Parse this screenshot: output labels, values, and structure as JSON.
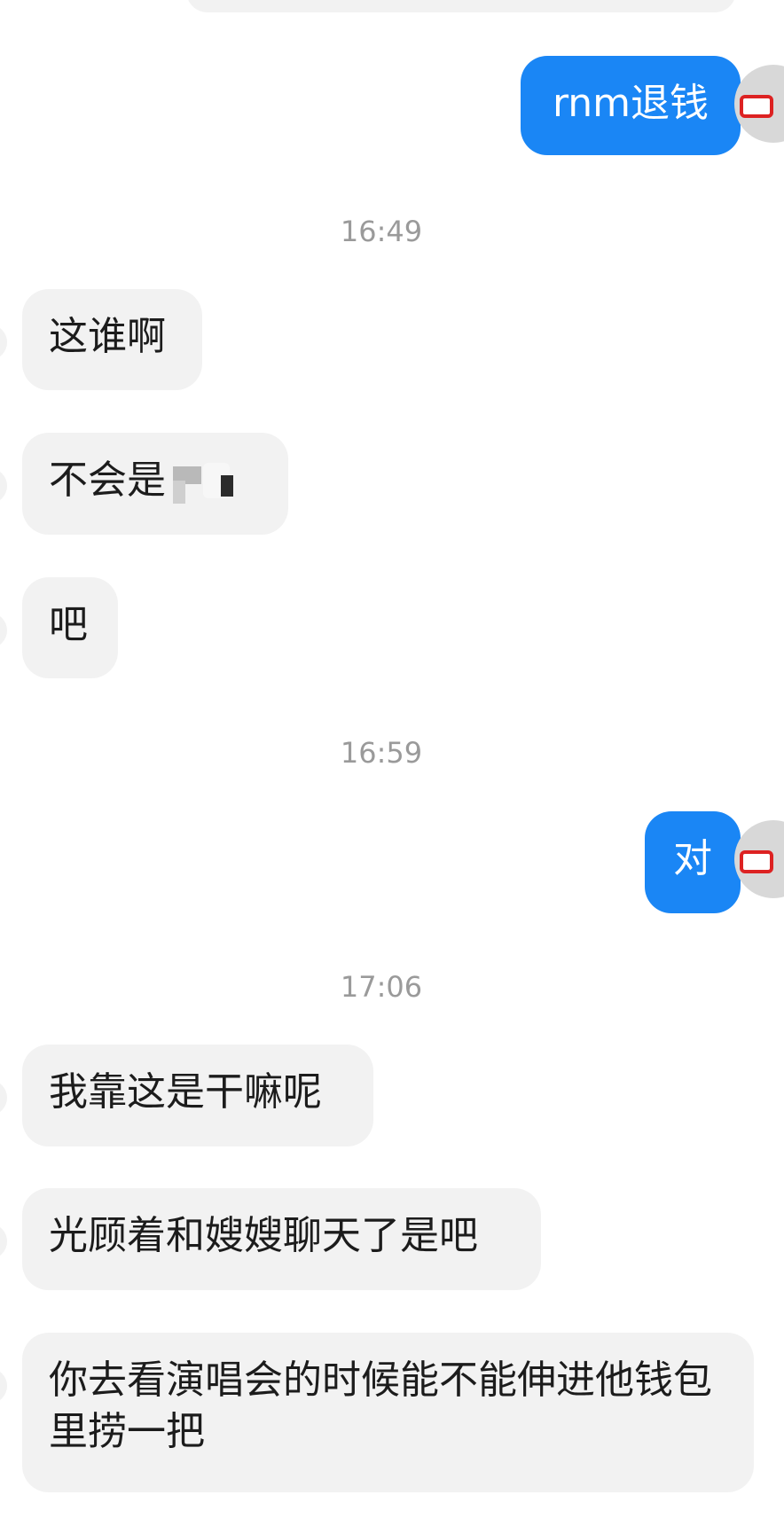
{
  "messages": [
    {
      "direction": "out",
      "text": "rnm退钱"
    },
    {
      "timestamp": "16:49"
    },
    {
      "direction": "in",
      "text": "这谁啊"
    },
    {
      "direction": "in",
      "text": "不会是"
    },
    {
      "direction": "in",
      "text": "吧"
    },
    {
      "timestamp": "16:59"
    },
    {
      "direction": "out",
      "text": "对"
    },
    {
      "timestamp": "17:06"
    },
    {
      "direction": "in",
      "text": "我靠这是干嘛呢"
    },
    {
      "direction": "in",
      "text": "光顾着和嫂嫂聊天了是吧"
    },
    {
      "direction": "in",
      "text": "你去看演唱会的时候能不能伸进他钱包里捞一把"
    }
  ],
  "colors": {
    "outgoing_bubble": "#1a86f5",
    "incoming_bubble": "#f2f2f2",
    "timestamp_text": "#9a9a9a"
  },
  "icons": {
    "avatar": "cartoon-avatar-with-red-glasses"
  }
}
